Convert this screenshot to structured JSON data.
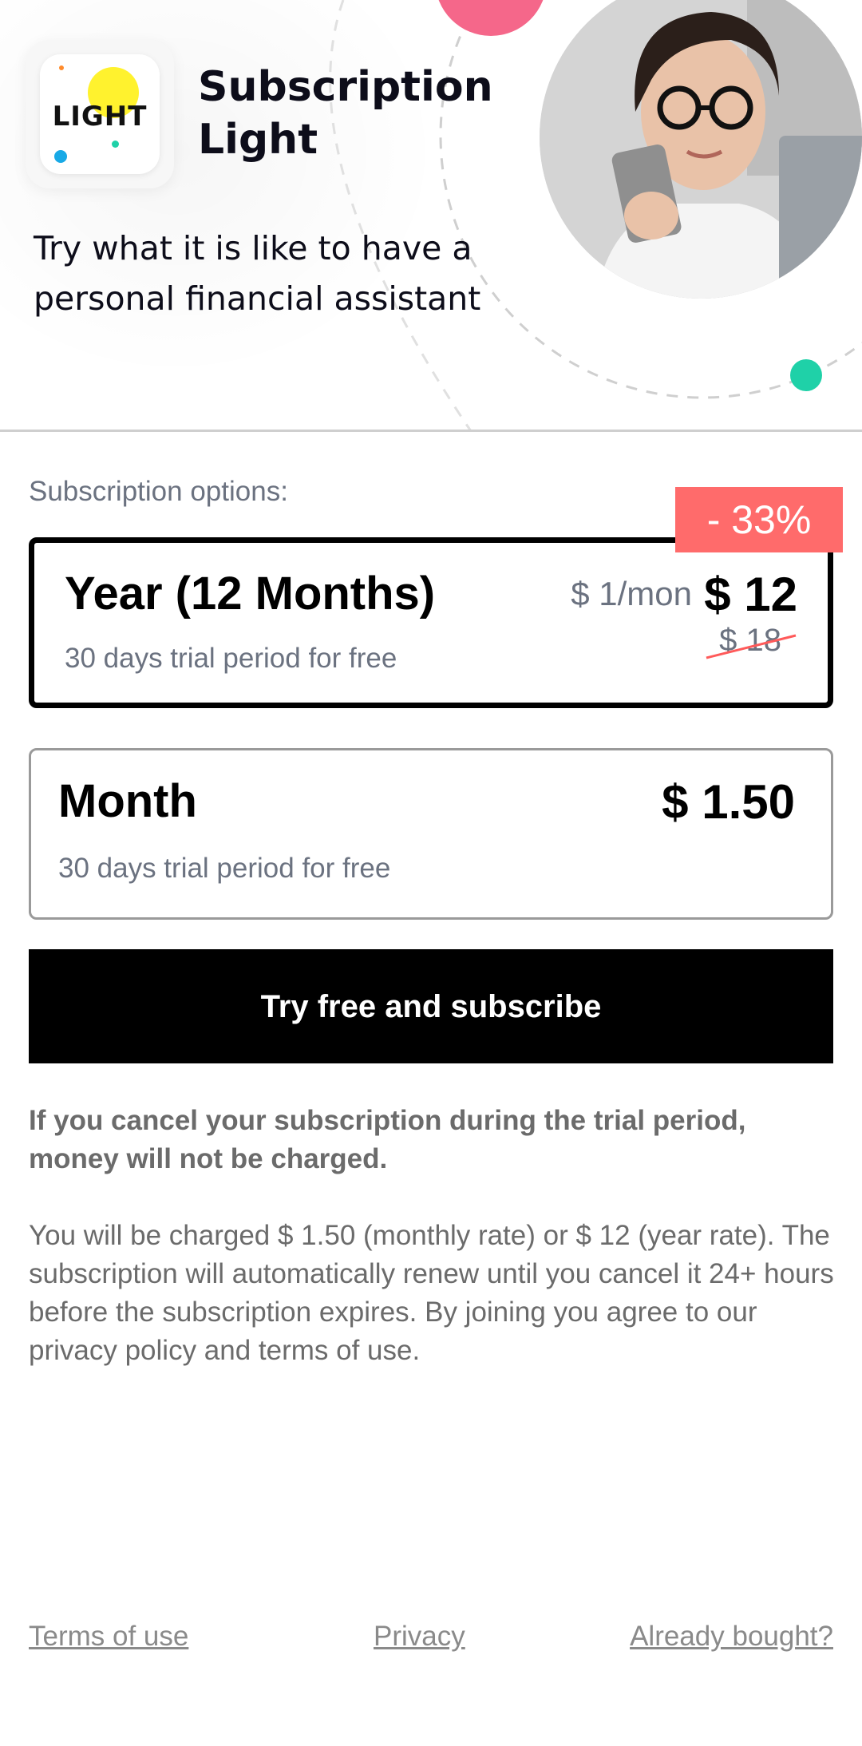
{
  "header": {
    "app_icon_text": "LIGHT",
    "title": "Subscription Light",
    "tagline": "Try what it is like to have a personal financial assistant"
  },
  "options": {
    "label": "Subscription options:",
    "discount_badge": "- 33%",
    "year": {
      "name": "Year (12 Months)",
      "trial": "30 days trial period for free",
      "per_month": "$ 1/mon",
      "price": "$ 12",
      "old_price": "$ 18"
    },
    "month": {
      "name": "Month",
      "trial": "30 days trial period for free",
      "price": "$ 1.50"
    }
  },
  "cta": {
    "label": "Try free and subscribe"
  },
  "notes": {
    "bold": "If you cancel your subscription during the trial period, money will not be charged.",
    "regular": "You will be charged $ 1.50 (monthly rate) or $ 12 (year rate). The subscription will automatically renew until you cancel it 24+ hours before the subscription expires. By joining you agree to our privacy policy and terms of use."
  },
  "footer": {
    "terms": "Terms of use",
    "privacy": "Privacy",
    "restore": "Already bought?"
  },
  "colors": {
    "accent_pink": "#f5678a",
    "accent_teal": "#1fd1a8",
    "discount_red": "#ff6b6b",
    "cta_bg": "#000000"
  }
}
